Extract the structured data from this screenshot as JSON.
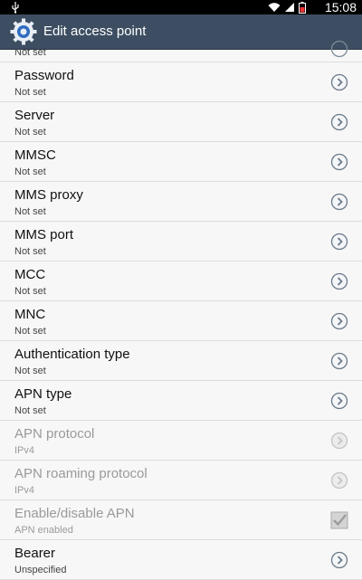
{
  "status_bar": {
    "time": "15:08",
    "icons": [
      "usb-icon",
      "wifi-icon",
      "signal-icon",
      "battery-icon"
    ]
  },
  "action_bar": {
    "title": "Edit access point",
    "icon": "settings-gear-icon"
  },
  "list": {
    "partial_item": {
      "summary": "Not set"
    },
    "items": [
      {
        "label": "Password",
        "summary": "Not set",
        "enabled": true,
        "widget": "chevron"
      },
      {
        "label": "Server",
        "summary": "Not set",
        "enabled": true,
        "widget": "chevron"
      },
      {
        "label": "MMSC",
        "summary": "Not set",
        "enabled": true,
        "widget": "chevron"
      },
      {
        "label": "MMS proxy",
        "summary": "Not set",
        "enabled": true,
        "widget": "chevron"
      },
      {
        "label": "MMS port",
        "summary": "Not set",
        "enabled": true,
        "widget": "chevron"
      },
      {
        "label": "MCC",
        "summary": "Not set",
        "enabled": true,
        "widget": "chevron"
      },
      {
        "label": "MNC",
        "summary": "Not set",
        "enabled": true,
        "widget": "chevron"
      },
      {
        "label": "Authentication type",
        "summary": "Not set",
        "enabled": true,
        "widget": "chevron"
      },
      {
        "label": "APN type",
        "summary": "Not set",
        "enabled": true,
        "widget": "chevron"
      },
      {
        "label": "APN protocol",
        "summary": "IPv4",
        "enabled": false,
        "widget": "chevron"
      },
      {
        "label": "APN roaming protocol",
        "summary": "IPv4",
        "enabled": false,
        "widget": "chevron"
      },
      {
        "label": "Enable/disable APN",
        "summary": "APN enabled",
        "enabled": false,
        "widget": "checkbox",
        "checked": true
      },
      {
        "label": "Bearer",
        "summary": "Unspecified",
        "enabled": true,
        "widget": "chevron"
      }
    ]
  },
  "colors": {
    "action_bar": "#3d4e62",
    "background": "#f7f7f7",
    "disabled_text": "#9a9a9a"
  }
}
